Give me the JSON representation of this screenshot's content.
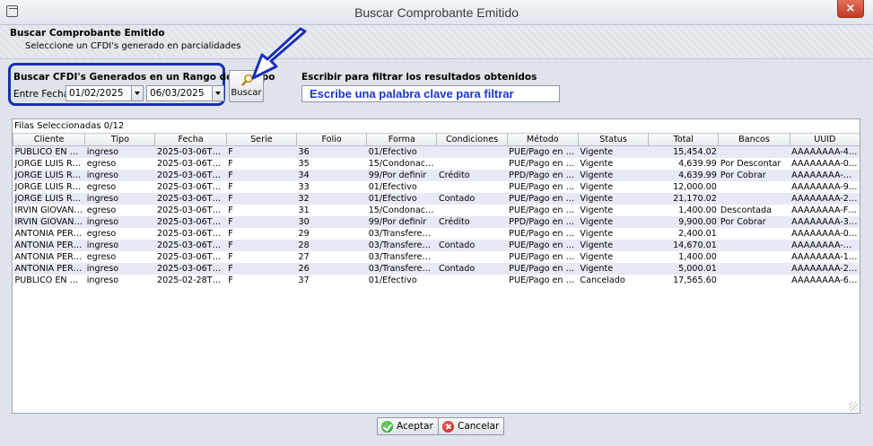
{
  "window": {
    "title": "Buscar Comprobante Emitido",
    "close_glyph": "×",
    "close_color": "#c9442f"
  },
  "header": {
    "title": "Buscar Comprobante Emitido",
    "subtitle": "Seleccione un CFDI's generado en parcialidades"
  },
  "range": {
    "title": "Buscar CFDI's Generados en un Rango de Tiempo",
    "label": "Entre Fechas",
    "from_date": "01/02/2025",
    "to_date": "06/03/2025",
    "highlight_color": "#1a2fb5"
  },
  "search_button": {
    "label": "Buscar",
    "icon": "magnifier-icon"
  },
  "filter": {
    "title": "Escribir para filtrar los resultados obtenidos",
    "placeholder": "Escribe una palabra clave para filtrar",
    "text_color": "#1a35c8"
  },
  "table": {
    "selected_count": "Filas Seleccionadas 0/12",
    "columns": [
      "Cliente",
      "Tipo",
      "Fecha",
      "Serie",
      "Folio",
      "Forma",
      "Condiciones",
      "Método",
      "Status",
      "Total",
      "Bancos",
      "UUID"
    ],
    "rows": [
      [
        "PUBLICO EN GE...",
        "ingreso",
        "2025-03-06T11:...",
        "F",
        "36",
        "01/Efectivo",
        "",
        "PUE/Pago en u...",
        "Vigente",
        "15,454.02",
        "",
        "AAAAAAAA-4F..."
      ],
      [
        "JORGE LUIS RO...",
        "egreso",
        "2025-03-06T11:...",
        "F",
        "35",
        "15/Condonación",
        "",
        "PUE/Pago en u...",
        "Vigente",
        "4,639.99",
        "Por Descontar",
        "AAAAAAAA-0B..."
      ],
      [
        "JORGE LUIS RO...",
        "ingreso",
        "2025-03-06T11:...",
        "F",
        "34",
        "99/Por definir",
        "Crédito",
        "PPD/Pago en p...",
        "Vigente",
        "4,639.99",
        "Por Cobrar",
        "AAAAAAAA-D5..."
      ],
      [
        "JORGE LUIS RO...",
        "egreso",
        "2025-03-06T11:...",
        "F",
        "33",
        "01/Efectivo",
        "",
        "PUE/Pago en u...",
        "Vigente",
        "12,000.00",
        "",
        "AAAAAAAA-9D..."
      ],
      [
        "JORGE LUIS RO...",
        "ingreso",
        "2025-03-06T11:...",
        "F",
        "32",
        "01/Efectivo",
        "Contado",
        "PUE/Pago en u...",
        "Vigente",
        "21,170.02",
        "",
        "AAAAAAAA-2E..."
      ],
      [
        "IRVIN GIOVANI ...",
        "egreso",
        "2025-03-06T11:...",
        "F",
        "31",
        "15/Condonación",
        "",
        "PUE/Pago en u...",
        "Vigente",
        "1,400.00",
        "Descontada",
        "AAAAAAAA-F1..."
      ],
      [
        "IRVIN GIOVANI ...",
        "ingreso",
        "2025-03-06T11:...",
        "F",
        "30",
        "99/Por definir",
        "Crédito",
        "PPD/Pago en p...",
        "Vigente",
        "9,900.00",
        "Por Cobrar",
        "AAAAAAAA-3E..."
      ],
      [
        "ANTONIA PERE...",
        "egreso",
        "2025-03-06T11:...",
        "F",
        "29",
        "03/Transferenci...",
        "",
        "PUE/Pago en u...",
        "Vigente",
        "2,400.01",
        "",
        "AAAAAAAA-03..."
      ],
      [
        "ANTONIA PERE...",
        "ingreso",
        "2025-03-06T11:...",
        "F",
        "28",
        "03/Transferenci...",
        "Contado",
        "PUE/Pago en u...",
        "Vigente",
        "14,670.01",
        "",
        "AAAAAAAA-D0..."
      ],
      [
        "ANTONIA PERE...",
        "egreso",
        "2025-03-06T11:...",
        "F",
        "27",
        "03/Transferenci...",
        "",
        "PUE/Pago en u...",
        "Vigente",
        "1,400.00",
        "",
        "AAAAAAAA-17..."
      ],
      [
        "ANTONIA PERE...",
        "ingreso",
        "2025-03-06T11:...",
        "F",
        "26",
        "03/Transferenci...",
        "Contado",
        "PUE/Pago en u...",
        "Vigente",
        "5,000.01",
        "",
        "AAAAAAAA-2B..."
      ],
      [
        "PUBLICO EN GE...",
        "ingreso",
        "2025-02-28T12:...",
        "F",
        "37",
        "01/Efectivo",
        "",
        "PUE/Pago en u...",
        "Cancelado",
        "17,565.60",
        "",
        "AAAAAAAA-6D..."
      ]
    ],
    "alt_row_color": "#e8e9f6"
  },
  "footer": {
    "accept_label": "Aceptar",
    "accept_icon": "check-circle-icon",
    "cancel_label": "Cancelar",
    "cancel_icon": "x-circle-icon"
  }
}
